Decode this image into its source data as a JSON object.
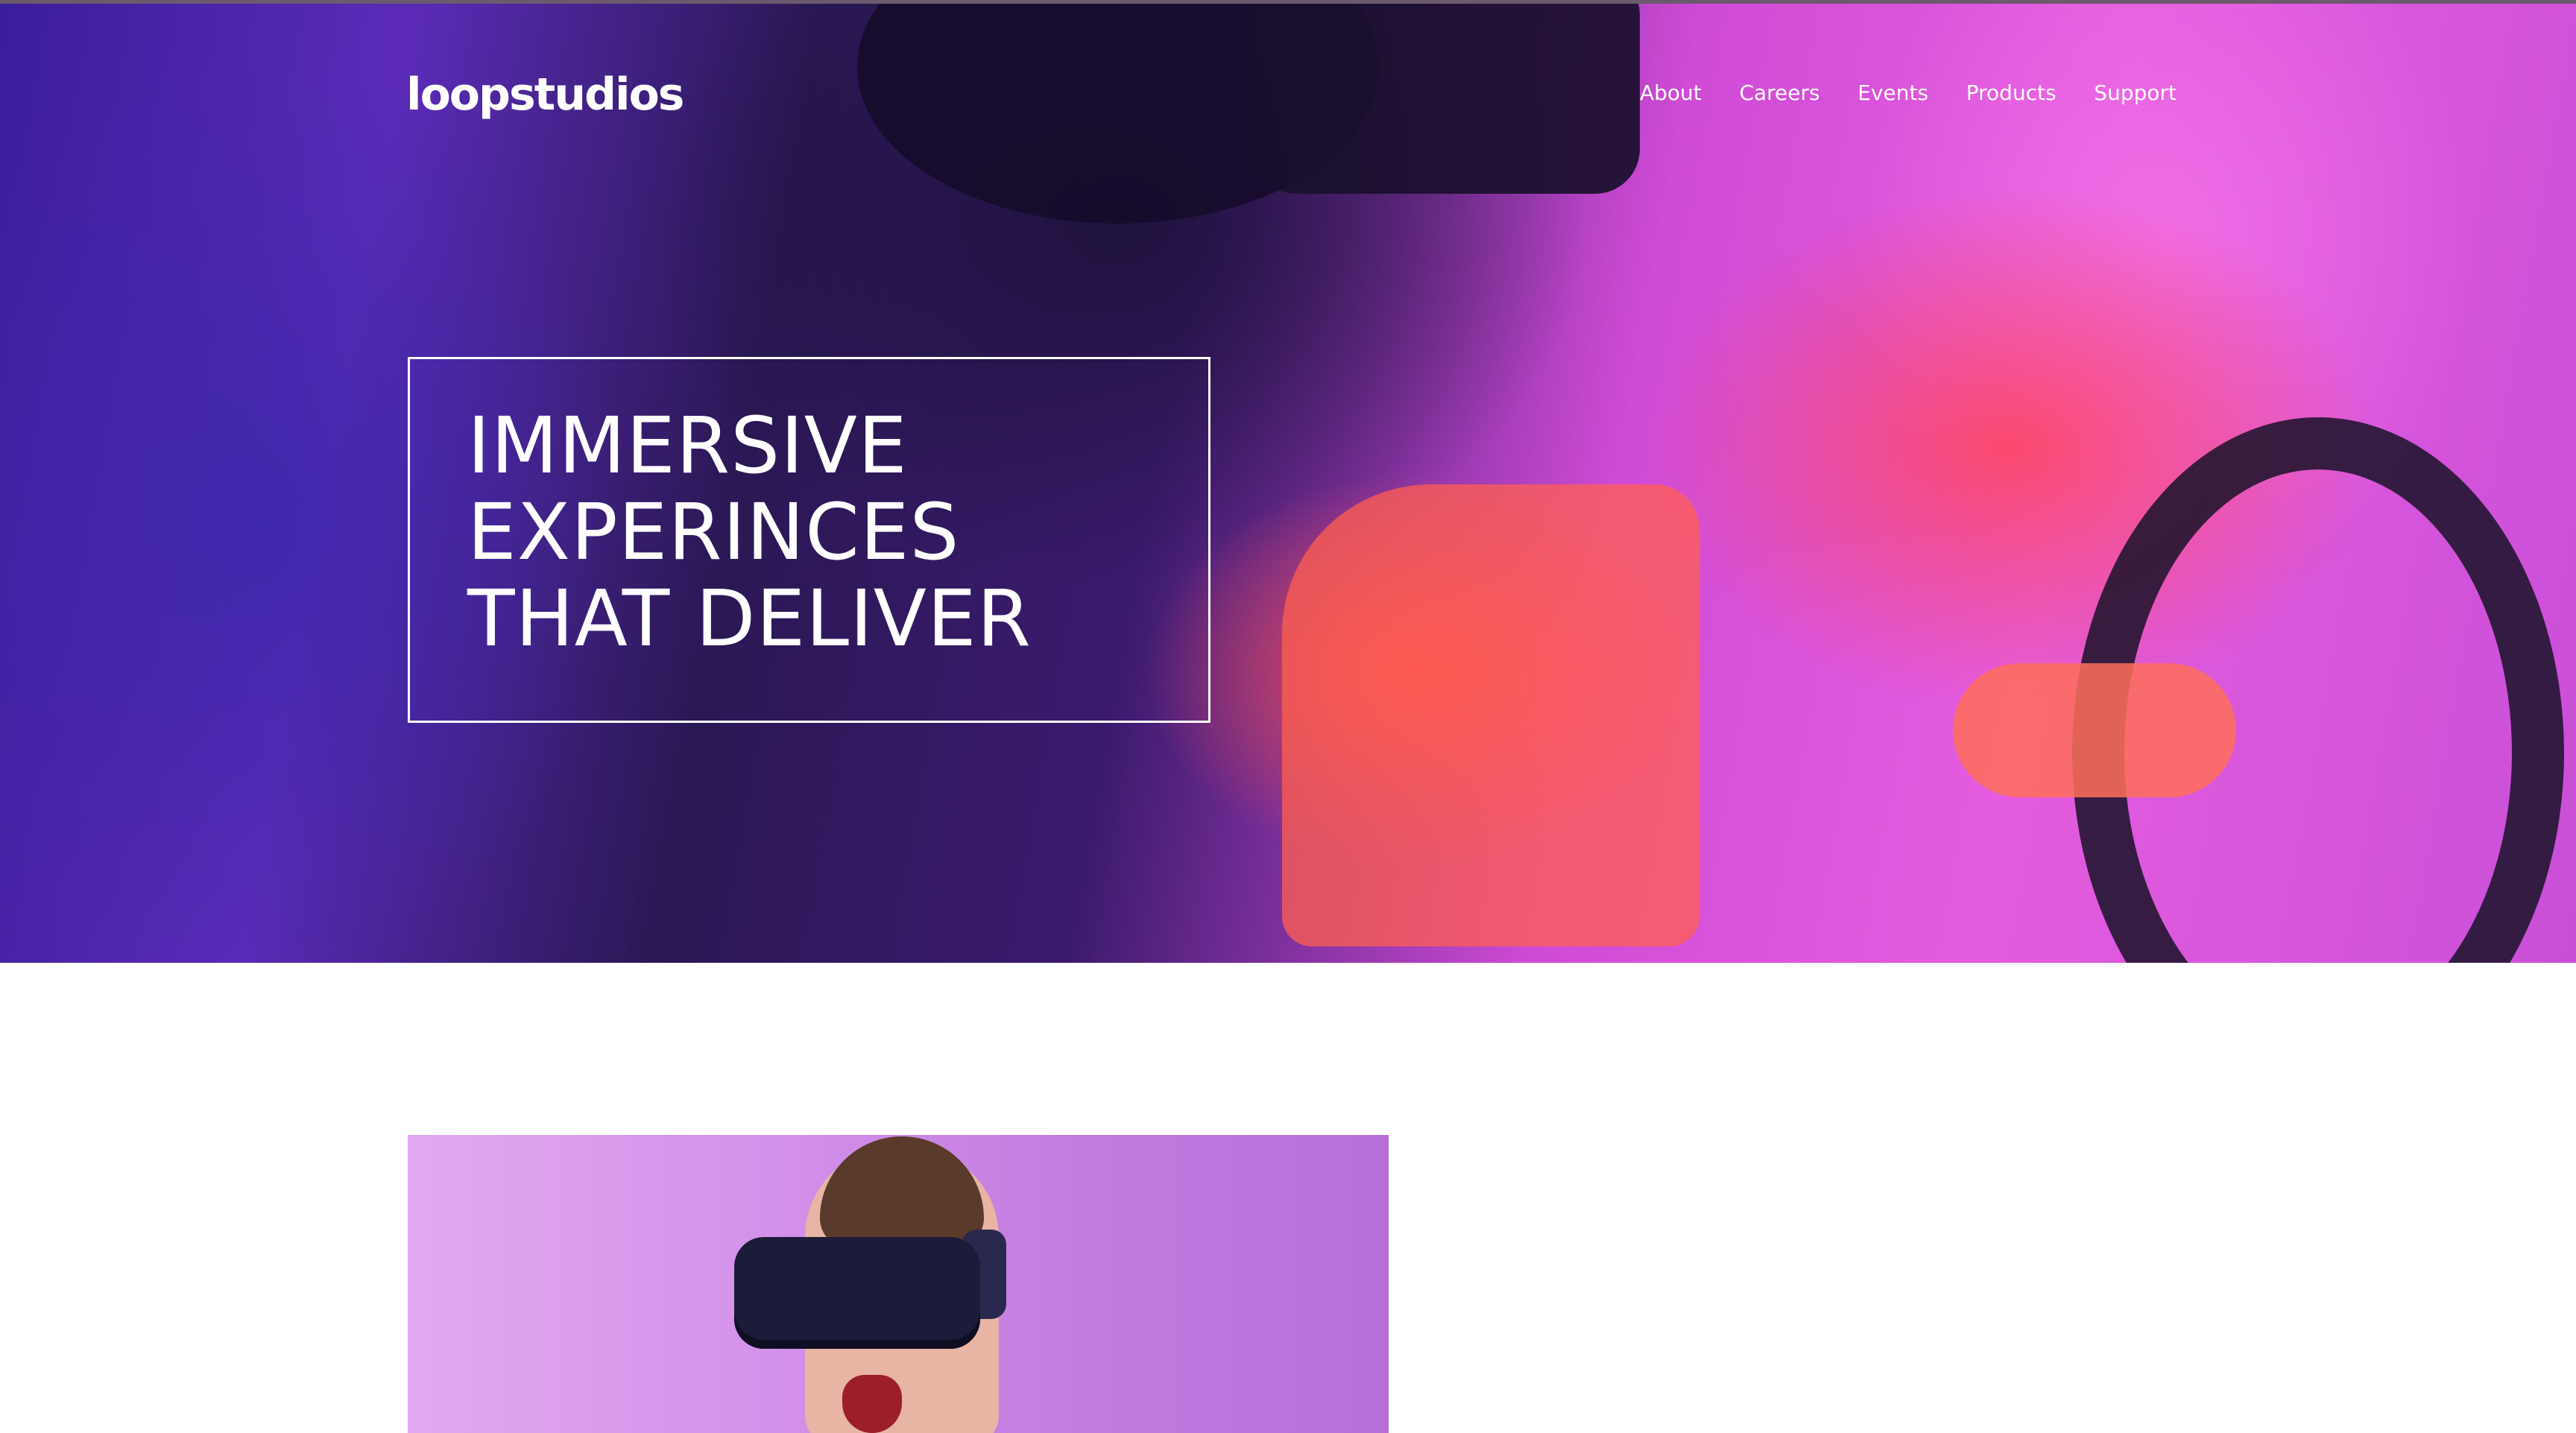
{
  "header": {
    "logo": "loopstudios",
    "nav": [
      "About",
      "Careers",
      "Events",
      "Products",
      "Support"
    ]
  },
  "hero": {
    "title_lines": [
      "IMMERSIVE",
      "EXPERINCES",
      "THAT DELIVER"
    ],
    "image_description_icon": "hero-vr-driving-photo-icon"
  },
  "content": {
    "image_icon": "vr-headset-person-photo-icon"
  },
  "colors": {
    "hero_purple": "#5b2bb8",
    "hero_pink": "#e45cdf",
    "hero_red": "#ff4650",
    "text": "#ffffff",
    "page_bg": "#ffffff"
  }
}
